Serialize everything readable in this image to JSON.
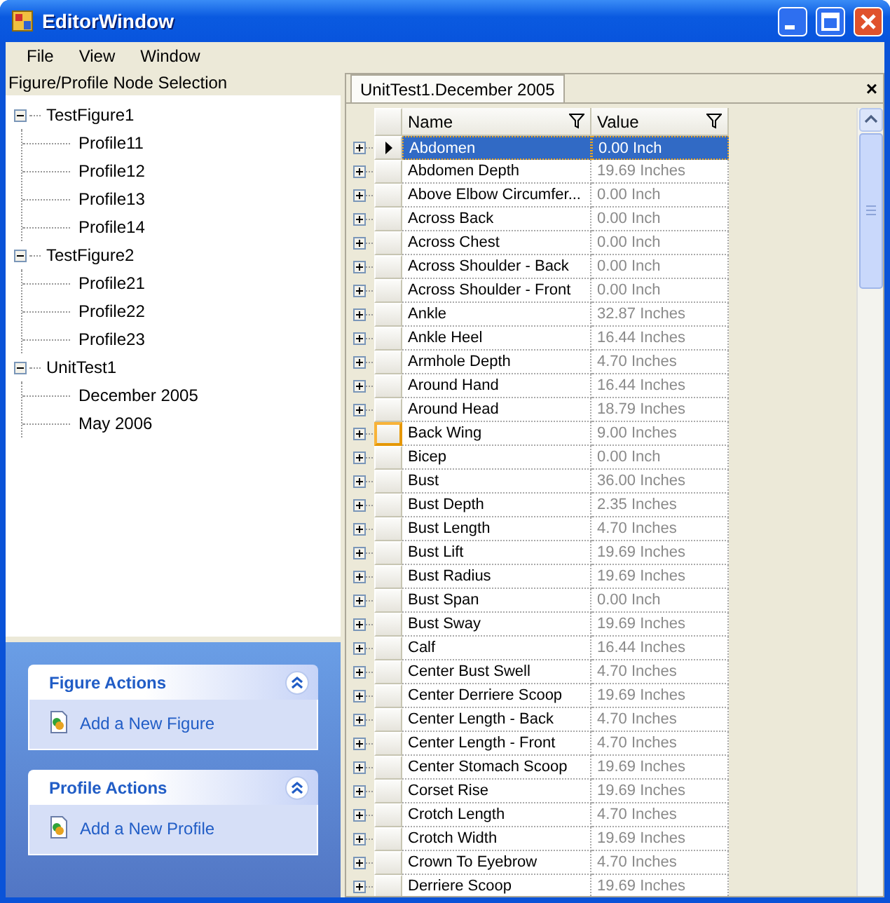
{
  "window": {
    "title": "EditorWindow"
  },
  "menu": [
    "File",
    "View",
    "Window"
  ],
  "tree": {
    "title": "Figure/Profile Node Selection",
    "nodes": [
      {
        "label": "TestFigure1",
        "expanded": true,
        "children": [
          {
            "label": "Profile11"
          },
          {
            "label": "Profile12"
          },
          {
            "label": "Profile13"
          },
          {
            "label": "Profile14"
          }
        ]
      },
      {
        "label": "TestFigure2",
        "expanded": true,
        "children": [
          {
            "label": "Profile21"
          },
          {
            "label": "Profile22"
          },
          {
            "label": "Profile23"
          }
        ]
      },
      {
        "label": "UnitTest1",
        "expanded": true,
        "children": [
          {
            "label": "December 2005"
          },
          {
            "label": "May 2006"
          }
        ]
      }
    ]
  },
  "task_pane": [
    {
      "title": "Figure Actions",
      "expanded": true,
      "items": [
        "Add a New Figure"
      ]
    },
    {
      "title": "Profile Actions",
      "expanded": true,
      "items": [
        "Add a New Profile"
      ]
    }
  ],
  "document_tab": {
    "label": "UnitTest1.December 2005",
    "close": "×"
  },
  "grid": {
    "columns": [
      "Name",
      "Value"
    ],
    "rows": [
      {
        "name": "Abdomen",
        "value": "0.00 Inch",
        "selected": true,
        "hovered": false
      },
      {
        "name": "Abdomen Depth",
        "value": "19.69 Inches",
        "selected": false,
        "hovered": false
      },
      {
        "name": "Above Elbow Circumfer...",
        "value": "0.00 Inch",
        "selected": false,
        "hovered": false
      },
      {
        "name": "Across Back",
        "value": "0.00 Inch",
        "selected": false,
        "hovered": false
      },
      {
        "name": "Across Chest",
        "value": "0.00 Inch",
        "selected": false,
        "hovered": false
      },
      {
        "name": "Across Shoulder - Back",
        "value": "0.00 Inch",
        "selected": false,
        "hovered": false
      },
      {
        "name": "Across Shoulder - Front",
        "value": "0.00 Inch",
        "selected": false,
        "hovered": false
      },
      {
        "name": "Ankle",
        "value": "32.87 Inches",
        "selected": false,
        "hovered": false
      },
      {
        "name": "Ankle Heel",
        "value": "16.44 Inches",
        "selected": false,
        "hovered": false
      },
      {
        "name": "Armhole Depth",
        "value": "4.70 Inches",
        "selected": false,
        "hovered": false
      },
      {
        "name": "Around Hand",
        "value": "16.44 Inches",
        "selected": false,
        "hovered": false
      },
      {
        "name": "Around Head",
        "value": "18.79 Inches",
        "selected": false,
        "hovered": false
      },
      {
        "name": "Back Wing",
        "value": "9.00 Inches",
        "selected": false,
        "hovered": true
      },
      {
        "name": "Bicep",
        "value": "0.00 Inch",
        "selected": false,
        "hovered": false
      },
      {
        "name": "Bust",
        "value": "36.00 Inches",
        "selected": false,
        "hovered": false
      },
      {
        "name": "Bust Depth",
        "value": "2.35 Inches",
        "selected": false,
        "hovered": false
      },
      {
        "name": "Bust Length",
        "value": "4.70 Inches",
        "selected": false,
        "hovered": false
      },
      {
        "name": "Bust Lift",
        "value": "19.69 Inches",
        "selected": false,
        "hovered": false
      },
      {
        "name": "Bust Radius",
        "value": "19.69 Inches",
        "selected": false,
        "hovered": false
      },
      {
        "name": "Bust Span",
        "value": "0.00 Inch",
        "selected": false,
        "hovered": false
      },
      {
        "name": "Bust Sway",
        "value": "19.69 Inches",
        "selected": false,
        "hovered": false
      },
      {
        "name": "Calf",
        "value": "16.44 Inches",
        "selected": false,
        "hovered": false
      },
      {
        "name": "Center Bust Swell",
        "value": "4.70 Inches",
        "selected": false,
        "hovered": false
      },
      {
        "name": "Center Derriere Scoop",
        "value": "19.69 Inches",
        "selected": false,
        "hovered": false
      },
      {
        "name": "Center Length - Back",
        "value": "4.70 Inches",
        "selected": false,
        "hovered": false
      },
      {
        "name": "Center Length - Front",
        "value": "4.70 Inches",
        "selected": false,
        "hovered": false
      },
      {
        "name": "Center Stomach Scoop",
        "value": "19.69 Inches",
        "selected": false,
        "hovered": false
      },
      {
        "name": "Corset Rise",
        "value": "19.69 Inches",
        "selected": false,
        "hovered": false
      },
      {
        "name": "Crotch Length",
        "value": "4.70 Inches",
        "selected": false,
        "hovered": false
      },
      {
        "name": "Crotch Width",
        "value": "19.69 Inches",
        "selected": false,
        "hovered": false
      },
      {
        "name": "Crown To Eyebrow",
        "value": "4.70 Inches",
        "selected": false,
        "hovered": false
      },
      {
        "name": "Derriere Scoop",
        "value": "19.69 Inches",
        "selected": false,
        "hovered": false
      }
    ]
  }
}
